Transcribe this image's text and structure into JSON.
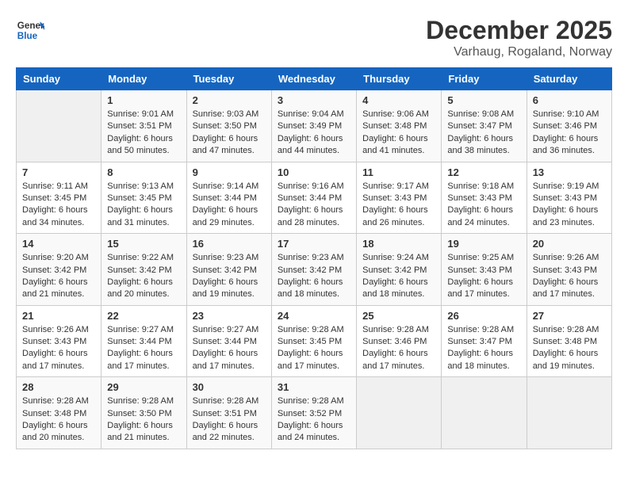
{
  "header": {
    "logo_line1": "General",
    "logo_line2": "Blue",
    "month": "December 2025",
    "location": "Varhaug, Rogaland, Norway"
  },
  "days_of_week": [
    "Sunday",
    "Monday",
    "Tuesday",
    "Wednesday",
    "Thursday",
    "Friday",
    "Saturday"
  ],
  "weeks": [
    [
      {
        "day": "",
        "sunrise": "",
        "sunset": "",
        "daylight": ""
      },
      {
        "day": "1",
        "sunrise": "Sunrise: 9:01 AM",
        "sunset": "Sunset: 3:51 PM",
        "daylight": "Daylight: 6 hours and 50 minutes."
      },
      {
        "day": "2",
        "sunrise": "Sunrise: 9:03 AM",
        "sunset": "Sunset: 3:50 PM",
        "daylight": "Daylight: 6 hours and 47 minutes."
      },
      {
        "day": "3",
        "sunrise": "Sunrise: 9:04 AM",
        "sunset": "Sunset: 3:49 PM",
        "daylight": "Daylight: 6 hours and 44 minutes."
      },
      {
        "day": "4",
        "sunrise": "Sunrise: 9:06 AM",
        "sunset": "Sunset: 3:48 PM",
        "daylight": "Daylight: 6 hours and 41 minutes."
      },
      {
        "day": "5",
        "sunrise": "Sunrise: 9:08 AM",
        "sunset": "Sunset: 3:47 PM",
        "daylight": "Daylight: 6 hours and 38 minutes."
      },
      {
        "day": "6",
        "sunrise": "Sunrise: 9:10 AM",
        "sunset": "Sunset: 3:46 PM",
        "daylight": "Daylight: 6 hours and 36 minutes."
      }
    ],
    [
      {
        "day": "7",
        "sunrise": "Sunrise: 9:11 AM",
        "sunset": "Sunset: 3:45 PM",
        "daylight": "Daylight: 6 hours and 34 minutes."
      },
      {
        "day": "8",
        "sunrise": "Sunrise: 9:13 AM",
        "sunset": "Sunset: 3:45 PM",
        "daylight": "Daylight: 6 hours and 31 minutes."
      },
      {
        "day": "9",
        "sunrise": "Sunrise: 9:14 AM",
        "sunset": "Sunset: 3:44 PM",
        "daylight": "Daylight: 6 hours and 29 minutes."
      },
      {
        "day": "10",
        "sunrise": "Sunrise: 9:16 AM",
        "sunset": "Sunset: 3:44 PM",
        "daylight": "Daylight: 6 hours and 28 minutes."
      },
      {
        "day": "11",
        "sunrise": "Sunrise: 9:17 AM",
        "sunset": "Sunset: 3:43 PM",
        "daylight": "Daylight: 6 hours and 26 minutes."
      },
      {
        "day": "12",
        "sunrise": "Sunrise: 9:18 AM",
        "sunset": "Sunset: 3:43 PM",
        "daylight": "Daylight: 6 hours and 24 minutes."
      },
      {
        "day": "13",
        "sunrise": "Sunrise: 9:19 AM",
        "sunset": "Sunset: 3:43 PM",
        "daylight": "Daylight: 6 hours and 23 minutes."
      }
    ],
    [
      {
        "day": "14",
        "sunrise": "Sunrise: 9:20 AM",
        "sunset": "Sunset: 3:42 PM",
        "daylight": "Daylight: 6 hours and 21 minutes."
      },
      {
        "day": "15",
        "sunrise": "Sunrise: 9:22 AM",
        "sunset": "Sunset: 3:42 PM",
        "daylight": "Daylight: 6 hours and 20 minutes."
      },
      {
        "day": "16",
        "sunrise": "Sunrise: 9:23 AM",
        "sunset": "Sunset: 3:42 PM",
        "daylight": "Daylight: 6 hours and 19 minutes."
      },
      {
        "day": "17",
        "sunrise": "Sunrise: 9:23 AM",
        "sunset": "Sunset: 3:42 PM",
        "daylight": "Daylight: 6 hours and 18 minutes."
      },
      {
        "day": "18",
        "sunrise": "Sunrise: 9:24 AM",
        "sunset": "Sunset: 3:42 PM",
        "daylight": "Daylight: 6 hours and 18 minutes."
      },
      {
        "day": "19",
        "sunrise": "Sunrise: 9:25 AM",
        "sunset": "Sunset: 3:43 PM",
        "daylight": "Daylight: 6 hours and 17 minutes."
      },
      {
        "day": "20",
        "sunrise": "Sunrise: 9:26 AM",
        "sunset": "Sunset: 3:43 PM",
        "daylight": "Daylight: 6 hours and 17 minutes."
      }
    ],
    [
      {
        "day": "21",
        "sunrise": "Sunrise: 9:26 AM",
        "sunset": "Sunset: 3:43 PM",
        "daylight": "Daylight: 6 hours and 17 minutes."
      },
      {
        "day": "22",
        "sunrise": "Sunrise: 9:27 AM",
        "sunset": "Sunset: 3:44 PM",
        "daylight": "Daylight: 6 hours and 17 minutes."
      },
      {
        "day": "23",
        "sunrise": "Sunrise: 9:27 AM",
        "sunset": "Sunset: 3:44 PM",
        "daylight": "Daylight: 6 hours and 17 minutes."
      },
      {
        "day": "24",
        "sunrise": "Sunrise: 9:28 AM",
        "sunset": "Sunset: 3:45 PM",
        "daylight": "Daylight: 6 hours and 17 minutes."
      },
      {
        "day": "25",
        "sunrise": "Sunrise: 9:28 AM",
        "sunset": "Sunset: 3:46 PM",
        "daylight": "Daylight: 6 hours and 17 minutes."
      },
      {
        "day": "26",
        "sunrise": "Sunrise: 9:28 AM",
        "sunset": "Sunset: 3:47 PM",
        "daylight": "Daylight: 6 hours and 18 minutes."
      },
      {
        "day": "27",
        "sunrise": "Sunrise: 9:28 AM",
        "sunset": "Sunset: 3:48 PM",
        "daylight": "Daylight: 6 hours and 19 minutes."
      }
    ],
    [
      {
        "day": "28",
        "sunrise": "Sunrise: 9:28 AM",
        "sunset": "Sunset: 3:48 PM",
        "daylight": "Daylight: 6 hours and 20 minutes."
      },
      {
        "day": "29",
        "sunrise": "Sunrise: 9:28 AM",
        "sunset": "Sunset: 3:50 PM",
        "daylight": "Daylight: 6 hours and 21 minutes."
      },
      {
        "day": "30",
        "sunrise": "Sunrise: 9:28 AM",
        "sunset": "Sunset: 3:51 PM",
        "daylight": "Daylight: 6 hours and 22 minutes."
      },
      {
        "day": "31",
        "sunrise": "Sunrise: 9:28 AM",
        "sunset": "Sunset: 3:52 PM",
        "daylight": "Daylight: 6 hours and 24 minutes."
      },
      {
        "day": "",
        "sunrise": "",
        "sunset": "",
        "daylight": ""
      },
      {
        "day": "",
        "sunrise": "",
        "sunset": "",
        "daylight": ""
      },
      {
        "day": "",
        "sunrise": "",
        "sunset": "",
        "daylight": ""
      }
    ]
  ]
}
